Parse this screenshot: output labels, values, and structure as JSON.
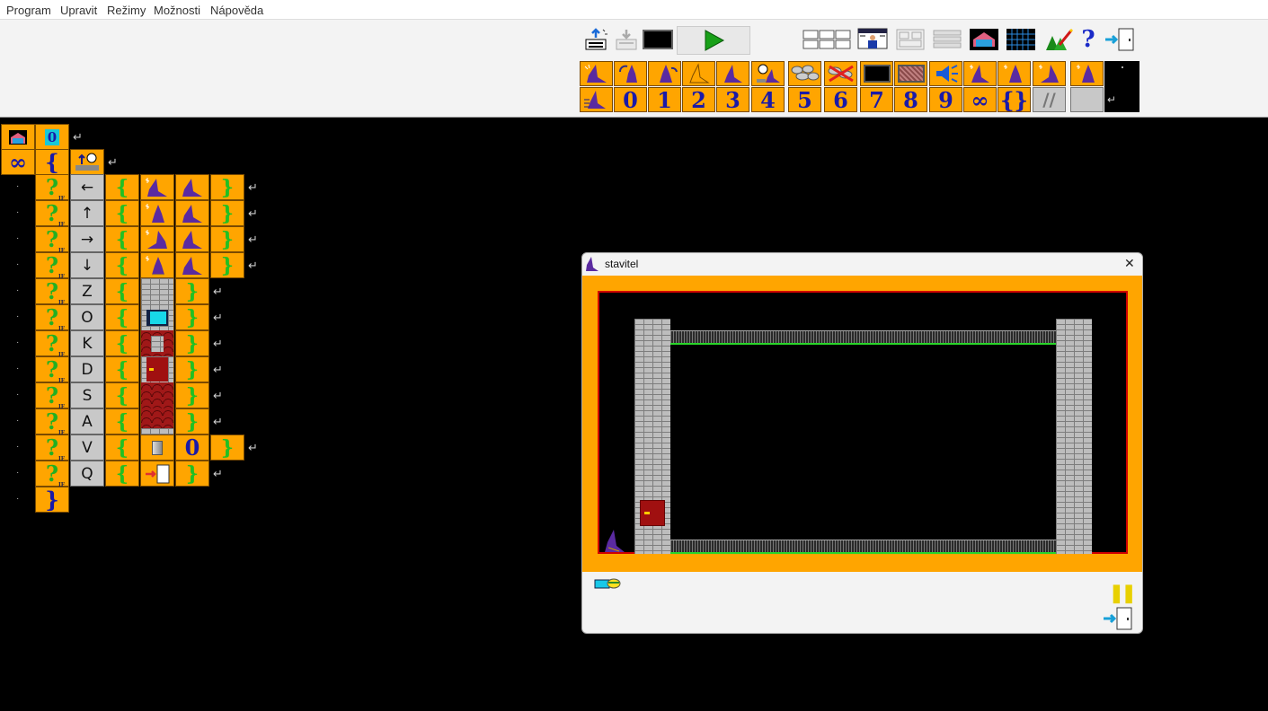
{
  "menu": [
    "Program",
    "Upravit",
    "Režimy",
    "Možnosti",
    "Nápověda"
  ],
  "toolbar": {
    "digits": [
      "0",
      "1",
      "2",
      "3",
      "4",
      "5",
      "6",
      "7",
      "8",
      "9"
    ],
    "infinity": "∞",
    "braces": "{}",
    "comment": "//",
    "enter": "↵"
  },
  "program": {
    "row1": {
      "count": "0"
    },
    "row2": {
      "loop": "∞",
      "open": "{"
    },
    "keys": [
      "←",
      "↑",
      "→",
      "↓",
      "Z",
      "O",
      "K",
      "D",
      "S",
      "A",
      "V",
      "Q"
    ],
    "open": "{",
    "close": "}",
    "if_label": "IF",
    "counter": "0",
    "final_close": "}",
    "enter": "↵",
    "dot": "·"
  },
  "window": {
    "title": "stavitel",
    "close": "✕",
    "pause": "❚❚"
  },
  "colors": {
    "accent": "#ffa500",
    "digit": "#1a1aa8",
    "brace": "#22c022",
    "frame_red": "#d00000"
  }
}
